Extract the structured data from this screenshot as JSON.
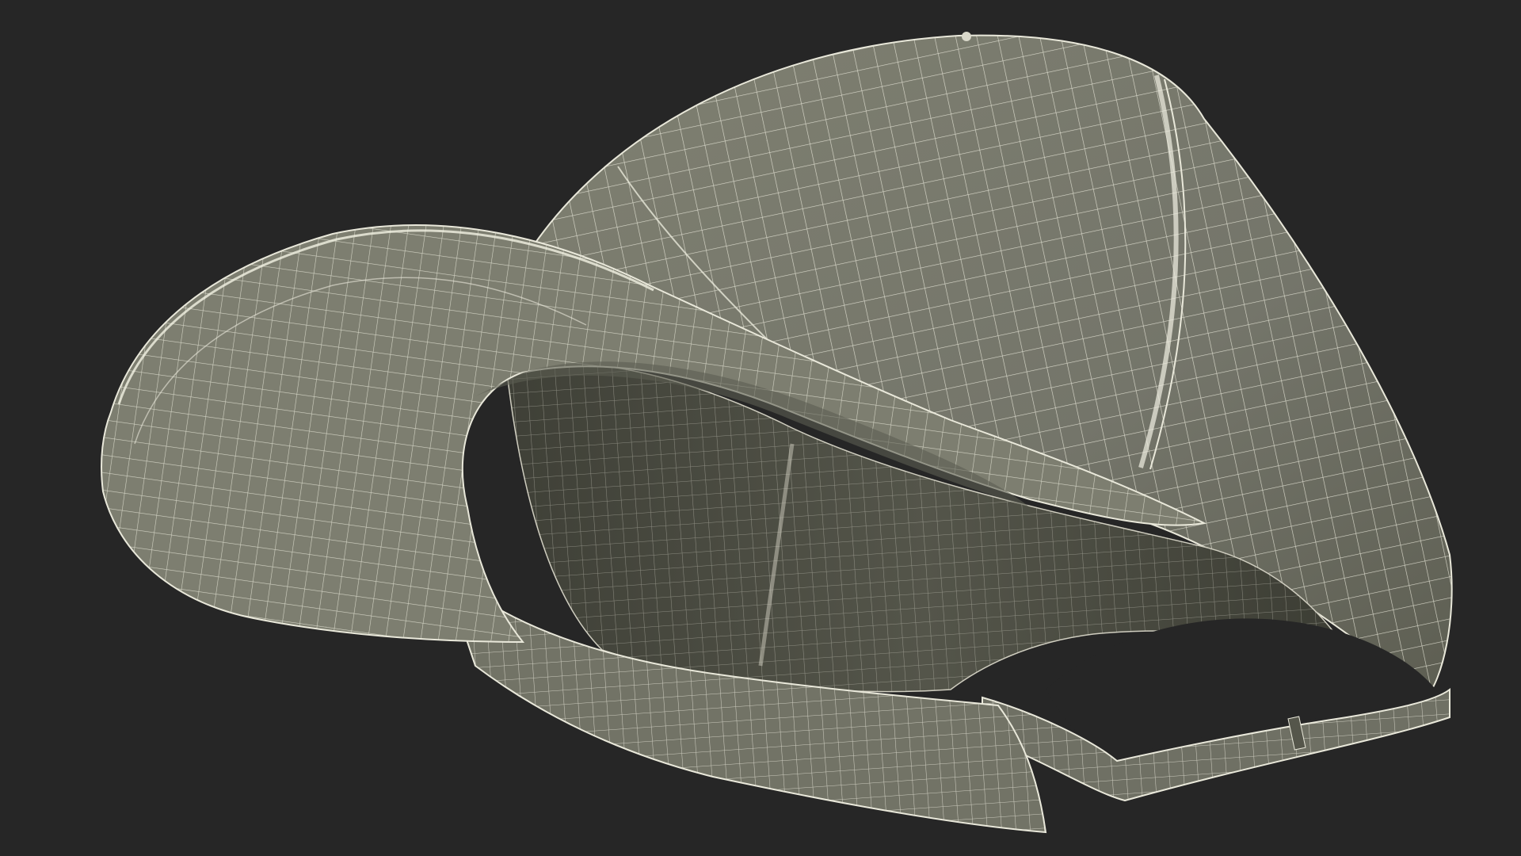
{
  "scene": {
    "subject": "baseball-cap-wireframe-render",
    "background_color": "#262626",
    "surface_color": "#767768",
    "surface_shadow_color": "#4e4f44",
    "inner_color": "#5a5b4f",
    "inner_dark_color": "#45463c",
    "wire_color": "#e9e8da"
  }
}
